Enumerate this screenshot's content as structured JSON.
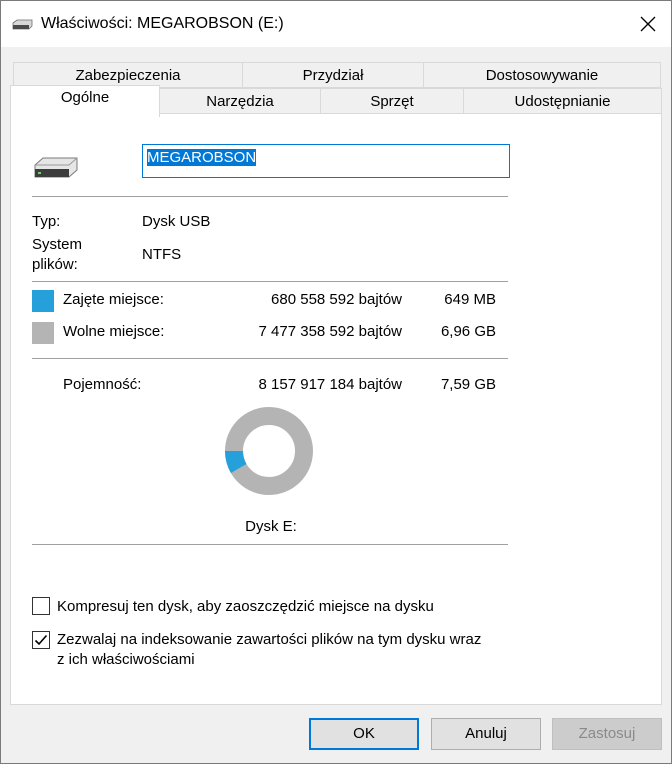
{
  "window": {
    "title": "Właściwości: MEGAROBSON (E:)"
  },
  "tabs_row1": [
    "Zabezpieczenia",
    "Przydział",
    "Dostosowywanie"
  ],
  "tabs_row2": [
    "Ogólne",
    "Narzędzia",
    "Sprzęt",
    "Udostępnianie"
  ],
  "active_tab": "Ogólne",
  "general": {
    "drive_name": "MEGAROBSON",
    "type_label": "Typ:",
    "type_value": "Dysk USB",
    "fs_label_line1": "System",
    "fs_label_line2": "plików:",
    "fs_value": "NTFS",
    "used_label": "Zajęte miejsce:",
    "used_bytes": "680 558 592 bajtów",
    "used_size": "649 MB",
    "free_label": "Wolne miejsce:",
    "free_bytes": "7 477 358 592 bajtów",
    "free_size": "6,96 GB",
    "capacity_label": "Pojemność:",
    "capacity_bytes": "8 157 917 184 bajtów",
    "capacity_size": "7,59 GB",
    "disk_label": "Dysk E:",
    "used_color": "#26a0da",
    "free_color": "#b4b4b4",
    "used_fraction": 0.0834
  },
  "options": {
    "compress_label": "Kompresuj ten dysk, aby zaoszczędzić miejsce na dysku",
    "compress_checked": false,
    "index_label_line1": "Zezwalaj na indeksowanie zawartości plików na tym dysku wraz",
    "index_label_line2": "z ich właściwościami",
    "index_checked": true
  },
  "buttons": {
    "ok": "OK",
    "cancel": "Anuluj",
    "apply": "Zastosuj"
  }
}
